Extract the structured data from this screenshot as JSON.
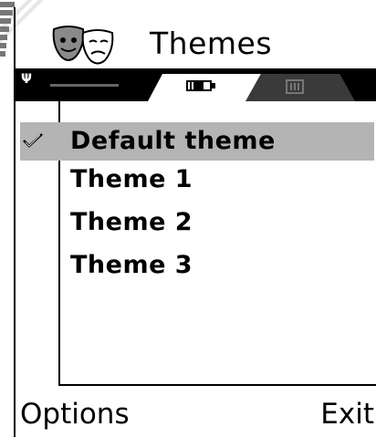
{
  "header": {
    "title": "Themes",
    "app_icon": "theater-masks-icon"
  },
  "tabs": {
    "indicator_icon": "antenna-icon",
    "items": [
      {
        "icon": "battery-tab-icon",
        "active": true
      },
      {
        "icon": "grid-tab-icon",
        "active": false
      }
    ]
  },
  "themes": {
    "items": [
      {
        "label": "Default theme",
        "selected": true,
        "checked": true
      },
      {
        "label": "Theme 1",
        "selected": false,
        "checked": false
      },
      {
        "label": "Theme 2",
        "selected": false,
        "checked": false
      },
      {
        "label": "Theme 3",
        "selected": false,
        "checked": false
      }
    ]
  },
  "softkeys": {
    "left": "Options",
    "right": "Exit"
  },
  "colors": {
    "highlight": "#b4b4b4",
    "tab_bar": "#000000",
    "inactive_tab": "#3a3a3a"
  }
}
